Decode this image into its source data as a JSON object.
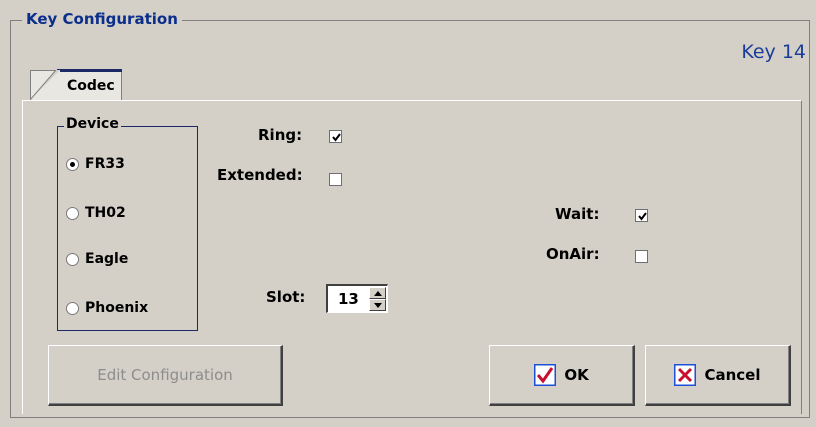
{
  "group": {
    "title": "Key Configuration",
    "key_label": "Key 14"
  },
  "tabs": [
    {
      "label": "Codec",
      "selected": true
    }
  ],
  "device": {
    "title": "Device",
    "options": [
      {
        "label": "FR33",
        "selected": true
      },
      {
        "label": "TH02",
        "selected": false
      },
      {
        "label": "Eagle",
        "selected": false
      },
      {
        "label": "Phoenix",
        "selected": false
      }
    ]
  },
  "fields": {
    "ring": {
      "label": "Ring:",
      "checked": true
    },
    "extended": {
      "label": "Extended:",
      "checked": false
    },
    "wait": {
      "label": "Wait:",
      "checked": true
    },
    "onair": {
      "label": "OnAir:",
      "checked": false
    },
    "slot": {
      "label": "Slot:",
      "value": "13"
    }
  },
  "buttons": {
    "edit_configuration": {
      "label": "Edit Configuration",
      "enabled": false
    },
    "ok": {
      "label": "OK",
      "icon": "check-icon"
    },
    "cancel": {
      "label": "Cancel",
      "icon": "x-icon"
    }
  },
  "colors": {
    "title_blue": "#0b2e8b",
    "ok_check": "#c8102e",
    "cancel_x": "#c8102e",
    "icon_border": "#1b4fd8"
  }
}
